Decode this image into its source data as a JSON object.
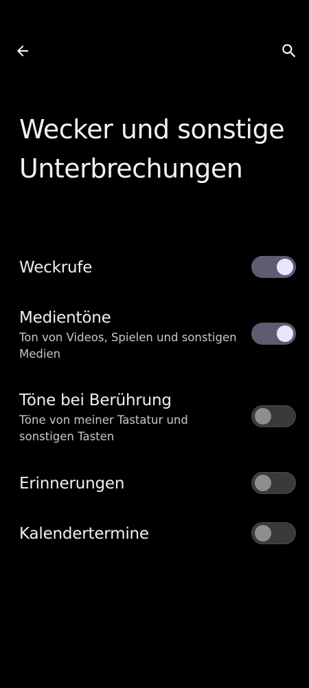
{
  "page": {
    "title": "Wecker und sonstige Unterbrechungen"
  },
  "app_bar": {
    "back_icon": "arrow-back-icon",
    "search_icon": "search-icon"
  },
  "settings": [
    {
      "title": "Weckrufe",
      "summary": "",
      "enabled": true
    },
    {
      "title": "Medientöne",
      "summary": "Ton von Videos, Spielen und sonstigen Medien",
      "enabled": true
    },
    {
      "title": "Töne bei Berührung",
      "summary": "Töne von meiner Tastatur und sonstigen Tasten",
      "enabled": false
    },
    {
      "title": "Erinnerungen",
      "summary": "",
      "enabled": false
    },
    {
      "title": "Kalendertermine",
      "summary": "",
      "enabled": false
    }
  ],
  "colors": {
    "background": "#000000",
    "toggle_on_track": "#5d5c70",
    "toggle_on_thumb": "#e8e6ff",
    "toggle_off_track": "#3a3a3c",
    "toggle_off_thumb": "#8e8e90"
  }
}
